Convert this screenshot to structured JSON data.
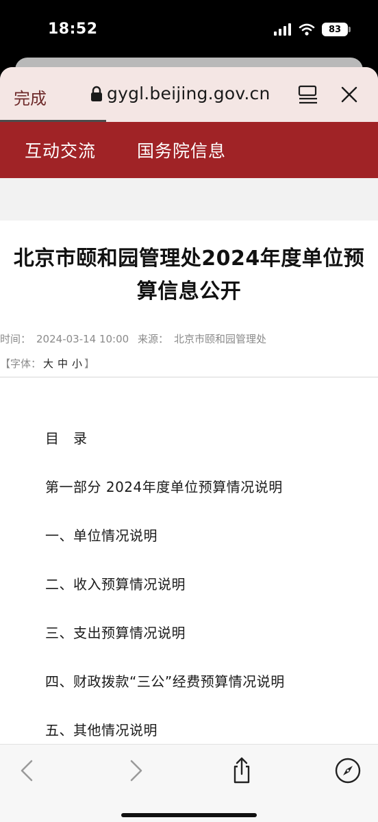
{
  "status_bar": {
    "time": "18:52",
    "battery": "83"
  },
  "browser": {
    "done_label": "完成",
    "url": "gygl.beijing.gov.cn",
    "load_progress": 0.28
  },
  "site_nav": {
    "items": [
      {
        "label": "互动交流"
      },
      {
        "label": "国务院信息"
      }
    ]
  },
  "article": {
    "title_line1": "北京市颐和园管理处2024年度单位预",
    "title_line2": "算信息公开",
    "meta": {
      "time_label": "时间：",
      "time_value": "2024-03-14 10:00",
      "source_label": "来源：",
      "source_value": "北京市颐和园管理处"
    },
    "font_size": {
      "prefix": "【字体：",
      "large": "大",
      "medium": "中",
      "small": "小",
      "suffix": "】"
    },
    "toc": [
      {
        "text": "目　录"
      },
      {
        "text": "第一部分 2024年度单位预算情况说明"
      },
      {
        "text": "一、单位情况说明"
      },
      {
        "text": "二、收入预算情况说明"
      },
      {
        "text": "三、支出预算情况说明"
      },
      {
        "text": "四、财政拨款“三公”经费预算情况说明"
      },
      {
        "text": "五、其他情况说明"
      }
    ]
  },
  "colors": {
    "brand_red": "#a02326",
    "header_tint": "#f4e6e4",
    "done_text": "#6e2a2a"
  },
  "icons": {
    "status": [
      "signal-icon",
      "wifi-icon",
      "battery-icon"
    ],
    "header": [
      "lock-icon",
      "reader-icon",
      "close-icon"
    ],
    "toolbar": [
      "back-icon",
      "forward-icon",
      "share-icon",
      "compass-icon"
    ]
  }
}
